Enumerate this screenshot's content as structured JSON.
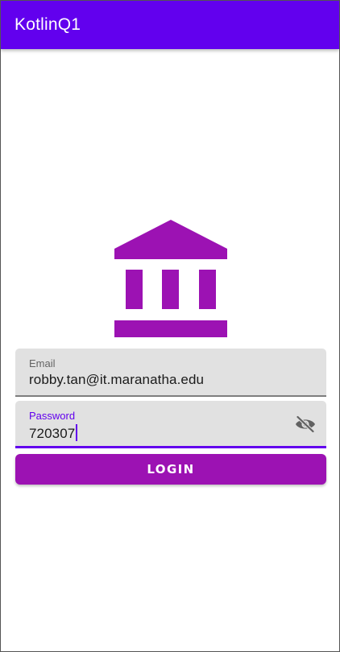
{
  "app_bar": {
    "title": "KotlinQ1"
  },
  "logo": {
    "icon": "bank-icon",
    "color": "#9c12b3"
  },
  "email_field": {
    "label": "Email",
    "value": "robby.tan@it.maranatha.edu"
  },
  "password_field": {
    "label": "Password",
    "value": "720307",
    "toggle_icon": "visibility-off-icon"
  },
  "login_button": {
    "label": "LOGIN"
  },
  "colors": {
    "primary": "#6200ee",
    "accent": "#9c12b3",
    "field_background": "#e1e1e1"
  }
}
